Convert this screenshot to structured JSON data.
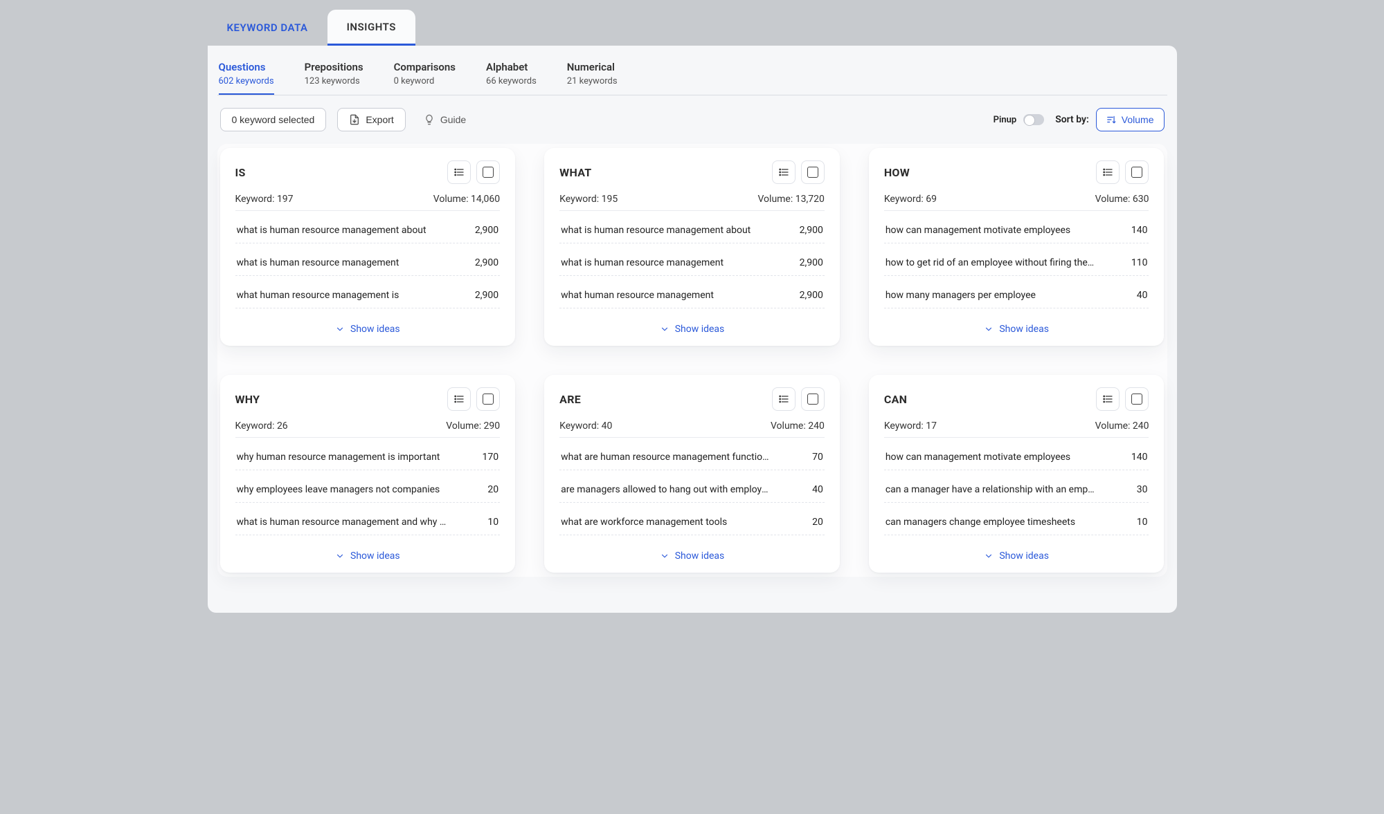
{
  "topTabs": {
    "keywordData": "KEYWORD DATA",
    "insights": "INSIGHTS"
  },
  "subTabs": [
    {
      "label": "Questions",
      "count": "602 keywords",
      "active": true
    },
    {
      "label": "Prepositions",
      "count": "123 keywords",
      "active": false
    },
    {
      "label": "Comparisons",
      "count": "0 keyword",
      "active": false
    },
    {
      "label": "Alphabet",
      "count": "66 keywords",
      "active": false
    },
    {
      "label": "Numerical",
      "count": "21 keywords",
      "active": false
    }
  ],
  "toolbar": {
    "selected": "0 keyword selected",
    "export": "Export",
    "guide": "Guide",
    "pinup": "Pinup",
    "sortBy": "Sort by:",
    "sortValue": "Volume"
  },
  "labels": {
    "keywordPrefix": "Keyword: ",
    "volumePrefix": "Volume: ",
    "showIdeas": "Show ideas"
  },
  "cards": [
    {
      "title": "IS",
      "keywordCount": "197",
      "volume": "14,060",
      "rows": [
        {
          "name": "what is human resource management about",
          "vol": "2,900"
        },
        {
          "name": "what is human resource management",
          "vol": "2,900"
        },
        {
          "name": "what human resource management is",
          "vol": "2,900"
        }
      ]
    },
    {
      "title": "WHAT",
      "keywordCount": "195",
      "volume": "13,720",
      "rows": [
        {
          "name": "what is human resource management about",
          "vol": "2,900"
        },
        {
          "name": "what is human resource management",
          "vol": "2,900"
        },
        {
          "name": "what human resource management",
          "vol": "2,900"
        }
      ]
    },
    {
      "title": "HOW",
      "keywordCount": "69",
      "volume": "630",
      "rows": [
        {
          "name": "how can management motivate employees",
          "vol": "140"
        },
        {
          "name": "how to get rid of an employee without firing them",
          "vol": "110"
        },
        {
          "name": "how many managers per employee",
          "vol": "40"
        }
      ]
    },
    {
      "title": "WHY",
      "keywordCount": "26",
      "volume": "290",
      "rows": [
        {
          "name": "why human resource management is important",
          "vol": "170"
        },
        {
          "name": "why employees leave managers not companies",
          "vol": "20"
        },
        {
          "name": "what is human resource management and why is it imp…",
          "vol": "10"
        }
      ]
    },
    {
      "title": "ARE",
      "keywordCount": "40",
      "volume": "240",
      "rows": [
        {
          "name": "what are human resource management functions",
          "vol": "70"
        },
        {
          "name": "are managers allowed to hang out with employees",
          "vol": "40"
        },
        {
          "name": "what are workforce management tools",
          "vol": "20"
        }
      ]
    },
    {
      "title": "CAN",
      "keywordCount": "17",
      "volume": "240",
      "rows": [
        {
          "name": "how can management motivate employees",
          "vol": "140"
        },
        {
          "name": "can a manager have a relationship with an employee",
          "vol": "30"
        },
        {
          "name": "can managers change employee timesheets",
          "vol": "10"
        }
      ]
    }
  ]
}
